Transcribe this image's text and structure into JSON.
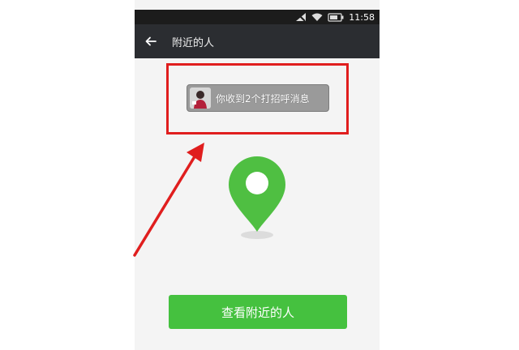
{
  "status_bar": {
    "time": "11:58"
  },
  "nav": {
    "title": "附近的人"
  },
  "notification": {
    "text": "你收到2个打招呼消息"
  },
  "main": {
    "view_nearby_button_label": "查看附近的人"
  },
  "colors": {
    "accent_green": "#45c13f",
    "highlight_red": "#e01e1e",
    "nav_bg": "#2b2d31"
  },
  "icons": {
    "back": "back-arrow-icon",
    "location": "location-pin-icon",
    "wifi": "wifi-icon",
    "battery": "battery-icon",
    "signal": "no-signal-icon"
  }
}
